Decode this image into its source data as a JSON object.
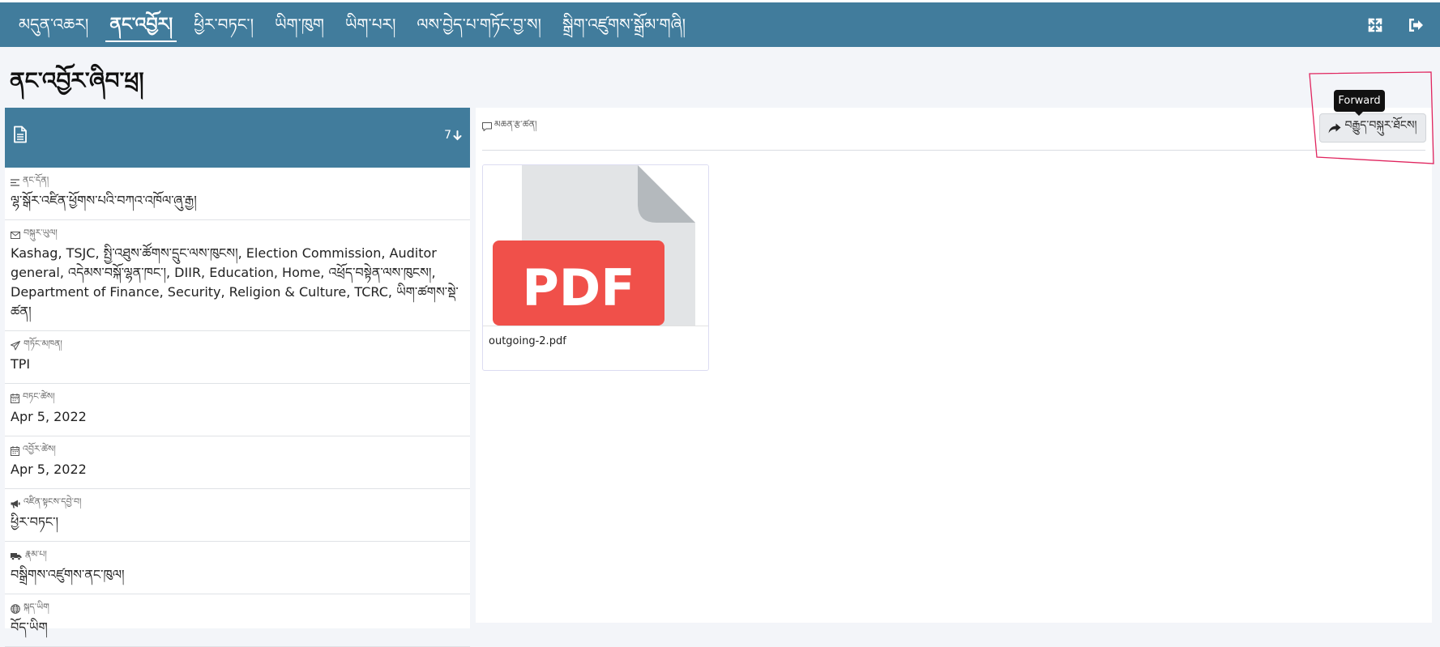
{
  "nav": {
    "items": [
      {
        "label": "མདུན་འཆར།",
        "active": false
      },
      {
        "label": "ནང་འབྱོར།",
        "active": true
      },
      {
        "label": "ཕྱིར་བཏང་།",
        "active": false
      },
      {
        "label": "ཡིག་ཁུག",
        "active": false
      },
      {
        "label": "ཡིག་པར།",
        "active": false
      },
      {
        "label": "ལས་བྱེད་པ་གཏོང་བྱ་ས།",
        "active": false
      },
      {
        "label": "སྒྲིག་འཛུགས་སྒྲོམ་གཞི།",
        "active": false
      }
    ],
    "right_icons": [
      "expand-icon",
      "logout-icon"
    ]
  },
  "page_title": "ནང་འབྱོར་ཞིབ་ཕྲ།",
  "panel": {
    "count": "7",
    "fields": [
      {
        "icon": "align-left-icon",
        "label": "ནང་དོན།",
        "value": "ལྷ་སྒོར་འཛིན་ཕྱོགས་པའི་བཀའ་འཁོལ་ཞུ་རྒྱ།"
      },
      {
        "icon": "envelope-icon",
        "label": "བསྐུར་ཡུལ།",
        "value": "Kashag, TSJC, སྤྱི་འཐུས་ཚོགས་དྲུང་ལས་ཁུངས།, Election Commission, Auditor general, འདེམས་བསྐོ་ལྷན་ཁང་།, DIIR, Education, Home, འཕྲོད་བསྟེན་ལས་ཁུངས།, Department of Finance, Security, Religion & Culture, TCRC, ཡིག་ཚགས་སྡེ་ཚན།"
      },
      {
        "icon": "paper-plane-icon",
        "label": "གཏོང་མཁན།",
        "value": "TPI"
      },
      {
        "icon": "calendar-icon",
        "label": "བཏང་ཚེས།",
        "value": "Apr 5, 2022"
      },
      {
        "icon": "calendar-icon",
        "label": "འབྱོར་ཚེས།",
        "value": "Apr 5, 2022"
      },
      {
        "icon": "bullhorn-icon",
        "label": "འཛིན་སྟངས་དབྱེ་བ།",
        "value": "ཕྱིར་བཏང་།"
      },
      {
        "icon": "truck-icon",
        "label": "རྣམ་པ།",
        "value": "བསྒྲིགས་འཛུགས་ནང་ཁུལ།"
      },
      {
        "icon": "globe-icon",
        "label": "སྐད་ཡིག",
        "value": "བོད་ཡིག"
      }
    ]
  },
  "main": {
    "comment_label": "མཆན་རྩ་ཚན།",
    "file": {
      "badge": "PDF",
      "name": "outgoing-2.pdf"
    },
    "forward_button": "བརྒྱུད་བསྐུར་ཐོངས།",
    "tooltip": "Forward"
  },
  "colors": {
    "topbar": "#417c9c",
    "pdf_red": "#f0504a",
    "highlight": "#e0245e"
  }
}
